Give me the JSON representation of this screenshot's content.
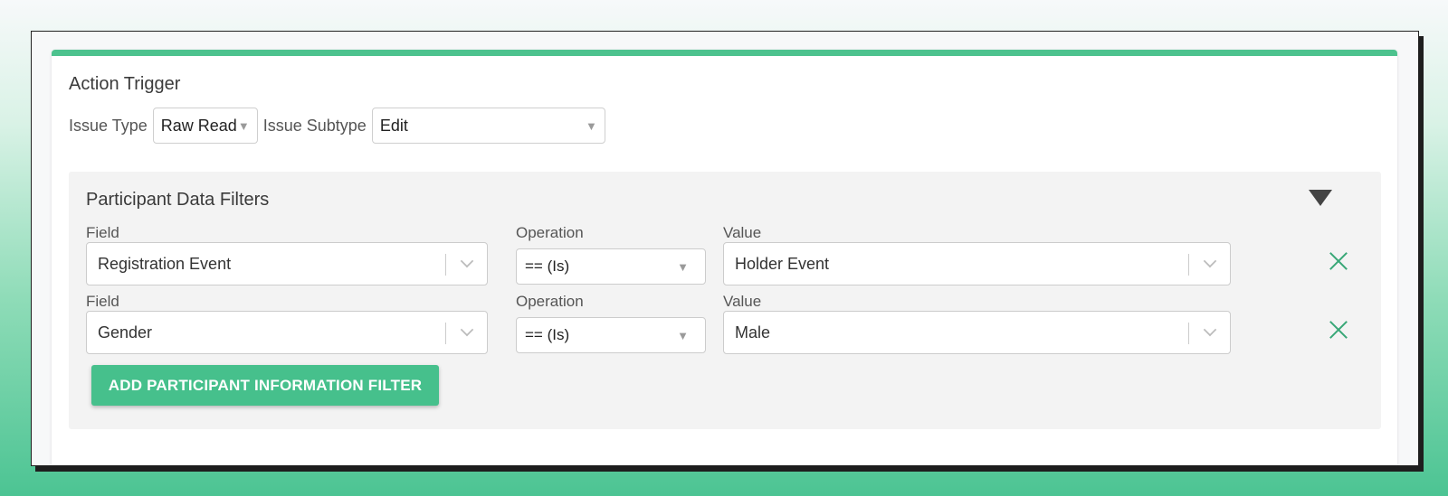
{
  "action_trigger": {
    "title": "Action Trigger",
    "issue_type_label": "Issue Type",
    "issue_type_value": "Raw Read",
    "issue_subtype_label": "Issue Subtype",
    "issue_subtype_value": "Edit"
  },
  "filters_panel": {
    "title": "Participant Data Filters",
    "collapse_icon": "triangle-down-icon",
    "rows": [
      {
        "field_label": "Field",
        "field_value": "Registration Event",
        "operation_label": "Operation",
        "operation_value": "== (Is)",
        "value_label": "Value",
        "value_value": "Holder Event"
      },
      {
        "field_label": "Field",
        "field_value": "Gender",
        "operation_label": "Operation",
        "operation_value": "== (Is)",
        "value_label": "Value",
        "value_value": "Male"
      }
    ],
    "add_button_label": "ADD PARTICIPANT INFORMATION FILTER"
  },
  "colors": {
    "accent": "#4dc28e",
    "delete_icon": "#38a777"
  }
}
